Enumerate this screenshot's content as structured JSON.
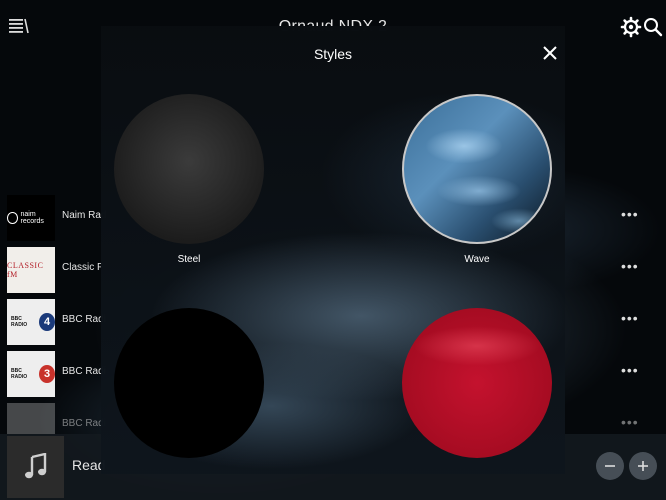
{
  "header": {
    "device_name": "Ornaud NDX 2",
    "icons": [
      "menu-icon",
      "gear-icon",
      "search-icon"
    ]
  },
  "stations": [
    {
      "name": "Naim Rad",
      "thumb": "naim",
      "thumb_text": "naim records"
    },
    {
      "name": "Classic F",
      "thumb": "classic",
      "thumb_text": "CLASSIC fM"
    },
    {
      "name": "BBC Radi",
      "thumb": "bbc4",
      "thumb_text": "BBC RADIO",
      "thumb_num": "4"
    },
    {
      "name": "BBC Radi",
      "thumb": "bbc3",
      "thumb_text": "BBC RADIO",
      "thumb_num": "3"
    },
    {
      "name": "BBC Radi",
      "thumb": "bbc5",
      "thumb_text": "",
      "thumb_num": ""
    }
  ],
  "row_more_label": "•••",
  "player": {
    "title": "Read",
    "art_icon": "music-note-icon"
  },
  "modal": {
    "title": "Styles",
    "close_icon": "close-icon",
    "options": [
      {
        "label": "Steel",
        "style": "steel",
        "selected": false
      },
      {
        "label": "Wave",
        "style": "wave",
        "selected": true
      },
      {
        "label": "",
        "style": "black",
        "selected": false
      },
      {
        "label": "",
        "style": "red",
        "selected": false
      }
    ]
  },
  "colors": {
    "background": "#000000",
    "text": "#ffffff",
    "selected_ring": "#c8c8c8",
    "red_style": "#c4122e"
  }
}
